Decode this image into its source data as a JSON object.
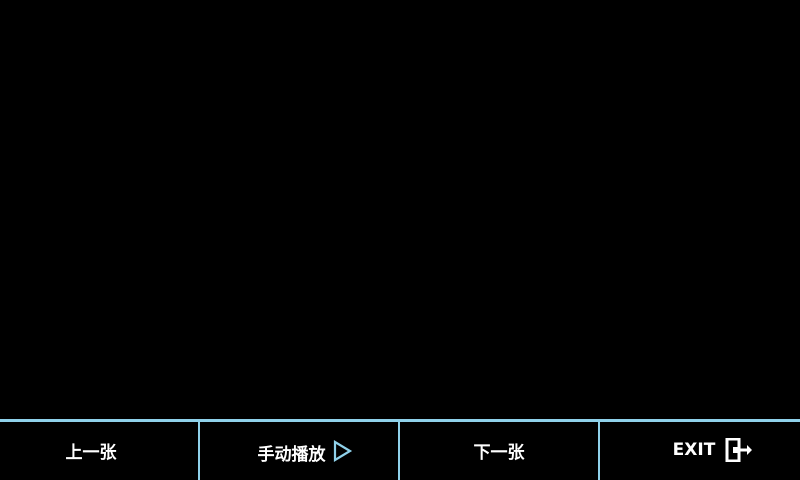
{
  "toolbar": {
    "prev_label": "上一张",
    "play_label": "手动播放",
    "play_icon": "play-outline-icon",
    "next_label": "下一张",
    "exit_label": "EXIT",
    "exit_icon": "exit-door-icon"
  },
  "colors": {
    "background": "#000000",
    "accent": "#8fd1ea",
    "text": "#ffffff"
  }
}
